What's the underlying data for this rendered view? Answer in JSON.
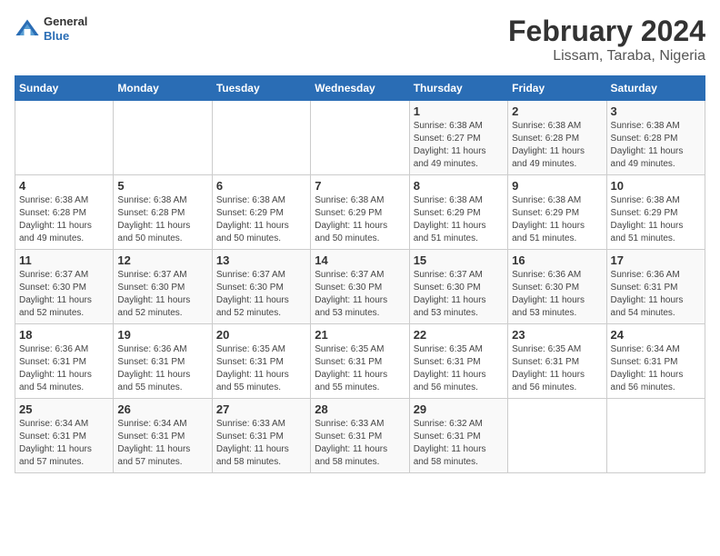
{
  "header": {
    "title": "February 2024",
    "subtitle": "Lissam, Taraba, Nigeria",
    "logo_general": "General",
    "logo_blue": "Blue"
  },
  "days_of_week": [
    "Sunday",
    "Monday",
    "Tuesday",
    "Wednesday",
    "Thursday",
    "Friday",
    "Saturday"
  ],
  "weeks": [
    [
      {
        "day": "",
        "info": ""
      },
      {
        "day": "",
        "info": ""
      },
      {
        "day": "",
        "info": ""
      },
      {
        "day": "",
        "info": ""
      },
      {
        "day": "1",
        "info": "Sunrise: 6:38 AM\nSunset: 6:27 PM\nDaylight: 11 hours\nand 49 minutes."
      },
      {
        "day": "2",
        "info": "Sunrise: 6:38 AM\nSunset: 6:28 PM\nDaylight: 11 hours\nand 49 minutes."
      },
      {
        "day": "3",
        "info": "Sunrise: 6:38 AM\nSunset: 6:28 PM\nDaylight: 11 hours\nand 49 minutes."
      }
    ],
    [
      {
        "day": "4",
        "info": "Sunrise: 6:38 AM\nSunset: 6:28 PM\nDaylight: 11 hours\nand 49 minutes."
      },
      {
        "day": "5",
        "info": "Sunrise: 6:38 AM\nSunset: 6:28 PM\nDaylight: 11 hours\nand 50 minutes."
      },
      {
        "day": "6",
        "info": "Sunrise: 6:38 AM\nSunset: 6:29 PM\nDaylight: 11 hours\nand 50 minutes."
      },
      {
        "day": "7",
        "info": "Sunrise: 6:38 AM\nSunset: 6:29 PM\nDaylight: 11 hours\nand 50 minutes."
      },
      {
        "day": "8",
        "info": "Sunrise: 6:38 AM\nSunset: 6:29 PM\nDaylight: 11 hours\nand 51 minutes."
      },
      {
        "day": "9",
        "info": "Sunrise: 6:38 AM\nSunset: 6:29 PM\nDaylight: 11 hours\nand 51 minutes."
      },
      {
        "day": "10",
        "info": "Sunrise: 6:38 AM\nSunset: 6:29 PM\nDaylight: 11 hours\nand 51 minutes."
      }
    ],
    [
      {
        "day": "11",
        "info": "Sunrise: 6:37 AM\nSunset: 6:30 PM\nDaylight: 11 hours\nand 52 minutes."
      },
      {
        "day": "12",
        "info": "Sunrise: 6:37 AM\nSunset: 6:30 PM\nDaylight: 11 hours\nand 52 minutes."
      },
      {
        "day": "13",
        "info": "Sunrise: 6:37 AM\nSunset: 6:30 PM\nDaylight: 11 hours\nand 52 minutes."
      },
      {
        "day": "14",
        "info": "Sunrise: 6:37 AM\nSunset: 6:30 PM\nDaylight: 11 hours\nand 53 minutes."
      },
      {
        "day": "15",
        "info": "Sunrise: 6:37 AM\nSunset: 6:30 PM\nDaylight: 11 hours\nand 53 minutes."
      },
      {
        "day": "16",
        "info": "Sunrise: 6:36 AM\nSunset: 6:30 PM\nDaylight: 11 hours\nand 53 minutes."
      },
      {
        "day": "17",
        "info": "Sunrise: 6:36 AM\nSunset: 6:31 PM\nDaylight: 11 hours\nand 54 minutes."
      }
    ],
    [
      {
        "day": "18",
        "info": "Sunrise: 6:36 AM\nSunset: 6:31 PM\nDaylight: 11 hours\nand 54 minutes."
      },
      {
        "day": "19",
        "info": "Sunrise: 6:36 AM\nSunset: 6:31 PM\nDaylight: 11 hours\nand 55 minutes."
      },
      {
        "day": "20",
        "info": "Sunrise: 6:35 AM\nSunset: 6:31 PM\nDaylight: 11 hours\nand 55 minutes."
      },
      {
        "day": "21",
        "info": "Sunrise: 6:35 AM\nSunset: 6:31 PM\nDaylight: 11 hours\nand 55 minutes."
      },
      {
        "day": "22",
        "info": "Sunrise: 6:35 AM\nSunset: 6:31 PM\nDaylight: 11 hours\nand 56 minutes."
      },
      {
        "day": "23",
        "info": "Sunrise: 6:35 AM\nSunset: 6:31 PM\nDaylight: 11 hours\nand 56 minutes."
      },
      {
        "day": "24",
        "info": "Sunrise: 6:34 AM\nSunset: 6:31 PM\nDaylight: 11 hours\nand 56 minutes."
      }
    ],
    [
      {
        "day": "25",
        "info": "Sunrise: 6:34 AM\nSunset: 6:31 PM\nDaylight: 11 hours\nand 57 minutes."
      },
      {
        "day": "26",
        "info": "Sunrise: 6:34 AM\nSunset: 6:31 PM\nDaylight: 11 hours\nand 57 minutes."
      },
      {
        "day": "27",
        "info": "Sunrise: 6:33 AM\nSunset: 6:31 PM\nDaylight: 11 hours\nand 58 minutes."
      },
      {
        "day": "28",
        "info": "Sunrise: 6:33 AM\nSunset: 6:31 PM\nDaylight: 11 hours\nand 58 minutes."
      },
      {
        "day": "29",
        "info": "Sunrise: 6:32 AM\nSunset: 6:31 PM\nDaylight: 11 hours\nand 58 minutes."
      },
      {
        "day": "",
        "info": ""
      },
      {
        "day": "",
        "info": ""
      }
    ]
  ]
}
